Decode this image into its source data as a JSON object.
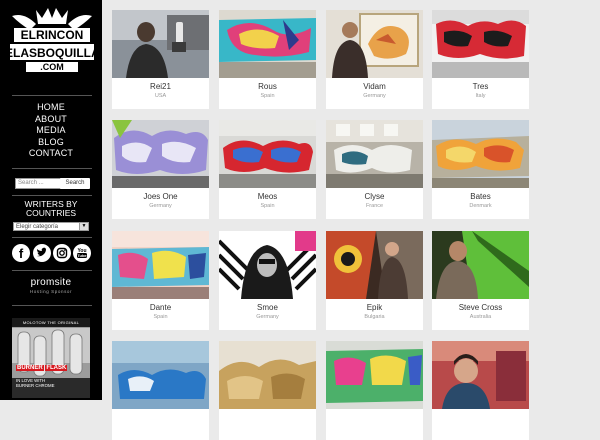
{
  "logo": {
    "text": "ELRINCON DELASBOQUILLAS .COM"
  },
  "nav": [
    "HOME",
    "ABOUT",
    "MEDIA",
    "BLOG",
    "CONTACT"
  ],
  "search": {
    "placeholder": "Search ...",
    "button": "Search"
  },
  "writers_heading": "WRITERS BY COUNTRIES",
  "category_select": {
    "selected": "Elegir categoría"
  },
  "social": [
    "facebook-icon",
    "twitter-icon",
    "instagram-icon",
    "youtube-icon"
  ],
  "sponsor": {
    "name": "promsite",
    "tagline": "Hosting Sponsor"
  },
  "ad": {
    "brand": "MOLOTOW THE ORIGINAL",
    "line1": "BURNER",
    "line2": "FLASK",
    "sub1": "IN LOVE WITH",
    "sub2": "BURNER CHROME"
  },
  "colors": {
    "sidebar": "#000000",
    "background": "#eaeaea",
    "card": "#ffffff"
  },
  "writers": [
    {
      "name": "Rei21",
      "country": "USA"
    },
    {
      "name": "Rous",
      "country": "Spain"
    },
    {
      "name": "Vidam",
      "country": "Germany"
    },
    {
      "name": "Tres",
      "country": "Italy"
    },
    {
      "name": "Joes One",
      "country": "Germany"
    },
    {
      "name": "Meos",
      "country": "Spain"
    },
    {
      "name": "Clyse",
      "country": "France"
    },
    {
      "name": "Bates",
      "country": "Denmark"
    },
    {
      "name": "Dante",
      "country": "Spain"
    },
    {
      "name": "Smoe",
      "country": "Germany"
    },
    {
      "name": "Epik",
      "country": "Bulgaria"
    },
    {
      "name": "Steve Cross",
      "country": "Australia"
    }
  ]
}
